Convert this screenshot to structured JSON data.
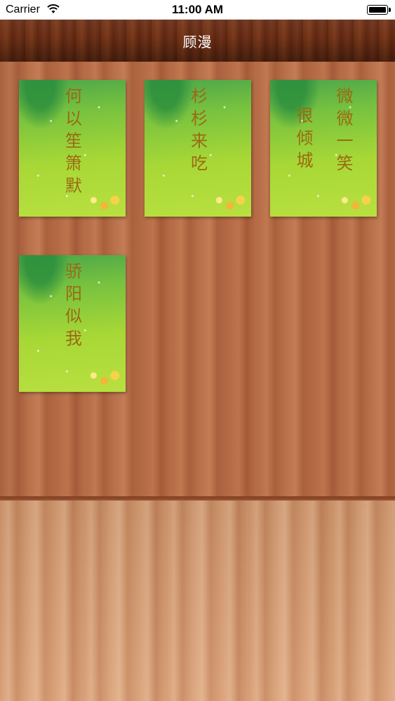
{
  "status_bar": {
    "carrier": "Carrier",
    "time": "11:00 AM",
    "wifi_icon": "wifi-icon",
    "battery_icon": "battery-icon"
  },
  "nav": {
    "title": "顾漫"
  },
  "books": [
    {
      "columns": [
        "何以笙箫默"
      ]
    },
    {
      "columns": [
        "杉杉来吃"
      ]
    },
    {
      "columns": [
        "微微一笑",
        "很倾城"
      ]
    },
    {
      "columns": [
        "骄阳似我"
      ]
    }
  ],
  "colors": {
    "nav_wood": "#6b2e14",
    "shelf_wood": "#b56b46",
    "cover_green": "#a8d836",
    "title_text": "#9a6a12"
  }
}
